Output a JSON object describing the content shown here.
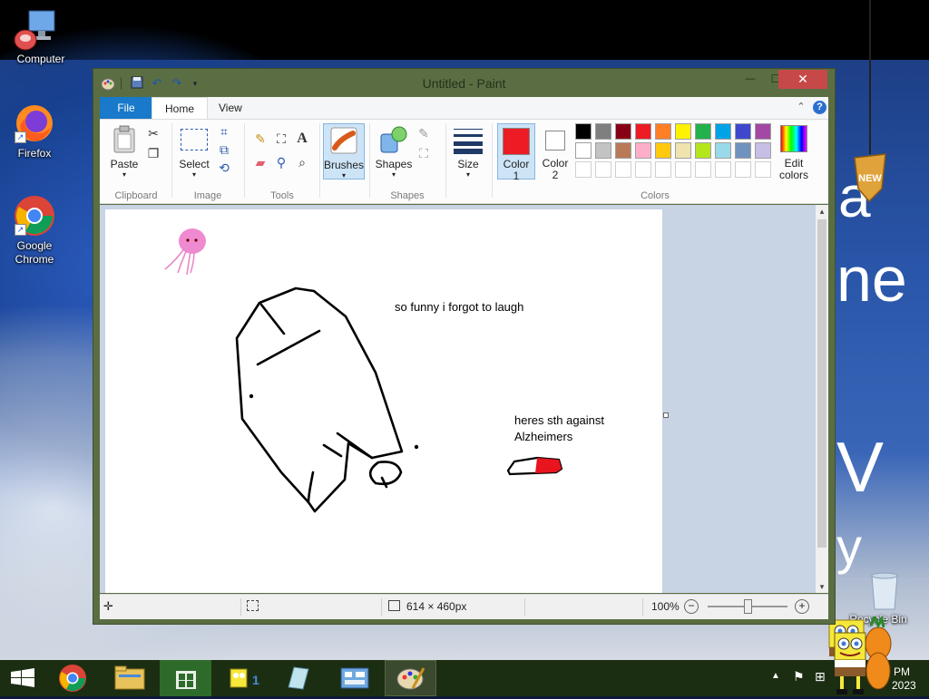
{
  "desktop": {
    "icons": [
      {
        "label": "Computer"
      },
      {
        "label": "Firefox"
      },
      {
        "label": "Google Chrome"
      },
      {
        "label": "Recycle Bin"
      }
    ],
    "shortcut_glyph": "↗",
    "wallpaper_text": [
      "a",
      "ne",
      "V",
      "y"
    ],
    "wallpaper_badge": "NEW"
  },
  "paint": {
    "title": "Untitled - Paint",
    "quick_access": [
      "save-icon",
      "undo-icon",
      "redo-icon",
      "customize-dropdown-icon"
    ],
    "window_buttons": {
      "minimize": "—",
      "maximize": "☐",
      "close": "✕"
    },
    "tabs": {
      "file": "File",
      "home": "Home",
      "view": "View"
    },
    "ribbon": {
      "clipboard": {
        "paste": "Paste",
        "group": "Clipboard"
      },
      "image": {
        "select": "Select",
        "group": "Image"
      },
      "tools": {
        "group": "Tools"
      },
      "brushes": "Brushes",
      "shapes": {
        "label": "Shapes",
        "group": "Shapes"
      },
      "size": "Size",
      "color1": {
        "line1": "Color",
        "line2": "1"
      },
      "color2": {
        "line1": "Color",
        "line2": "2"
      },
      "colors_group": "Colors",
      "edit_colors": {
        "line1": "Edit",
        "line2": "colors"
      }
    },
    "colors": {
      "color1": "#ed1c24",
      "color2": "#ffffff",
      "palette_row1": [
        "#000000",
        "#7f7f7f",
        "#880015",
        "#ed1c24",
        "#ff7f27",
        "#fff200",
        "#22b14c",
        "#00a2e8",
        "#3f48cc",
        "#a349a4"
      ],
      "palette_row2": [
        "#ffffff",
        "#c3c3c3",
        "#b97a57",
        "#ffaec9",
        "#ffc90e",
        "#efe4b0",
        "#b5e61d",
        "#99d9ea",
        "#7092be",
        "#c8bfe7"
      ],
      "palette_row3": [
        "#ffffff",
        "#ffffff",
        "#ffffff",
        "#ffffff",
        "#ffffff",
        "#ffffff",
        "#ffffff",
        "#ffffff",
        "#ffffff",
        "#ffffff"
      ]
    },
    "canvas_text": {
      "joke": "so funny i forgot to laugh",
      "note_line1": "heres sth against",
      "note_line2": "Alzheimers"
    },
    "status": {
      "image_size": "614 × 460px",
      "zoom": "100%",
      "zoom_level": 0.5
    }
  },
  "taskbar": {
    "items": [
      "start-button",
      "chrome-icon",
      "file-explorer-icon",
      "store-icon",
      "spongebob-app-icon",
      "notes-app-icon",
      "control-panel-icon",
      "paint-icon"
    ],
    "clock_time": "PM",
    "clock_date": "2023"
  }
}
